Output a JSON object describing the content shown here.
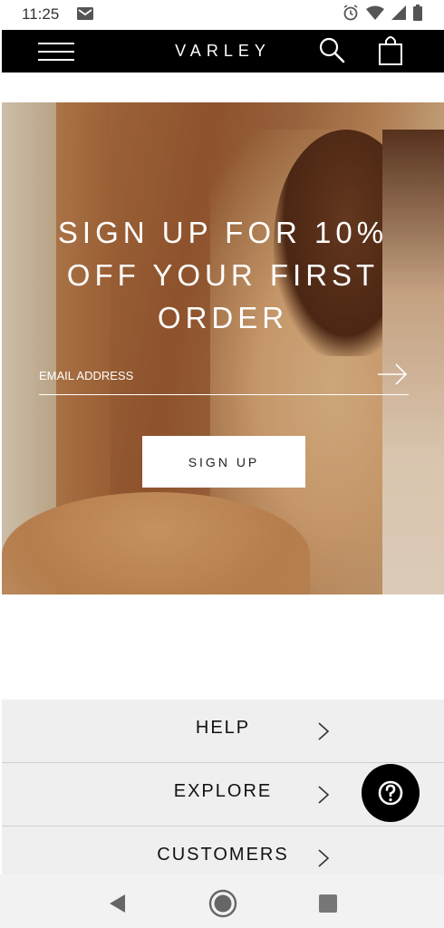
{
  "status_bar": {
    "time": "11:25",
    "icons": [
      "mail-icon",
      "alarm-icon",
      "wifi-icon",
      "signal-icon",
      "battery-icon"
    ]
  },
  "header": {
    "brand": "VARLEY",
    "icons": [
      "menu-icon",
      "search-icon",
      "shopping-bag-icon"
    ],
    "background_color": "#000000"
  },
  "hero": {
    "title": "SIGN UP FOR 10% OFF YOUR FIRST ORDER",
    "email_placeholder": "EMAIL ADDRESS",
    "submit_icon": "arrow-right-icon",
    "signup_label": "SIGN UP"
  },
  "footer": {
    "items": [
      {
        "label": "HELP"
      },
      {
        "label": "EXPLORE"
      },
      {
        "label": "CUSTOMERS"
      }
    ],
    "chevron_icon": "chevron-right-icon"
  },
  "help_button": {
    "icon": "question-mark-icon"
  },
  "system_nav": {
    "icons": [
      "back-icon",
      "home-icon",
      "recents-icon"
    ]
  }
}
